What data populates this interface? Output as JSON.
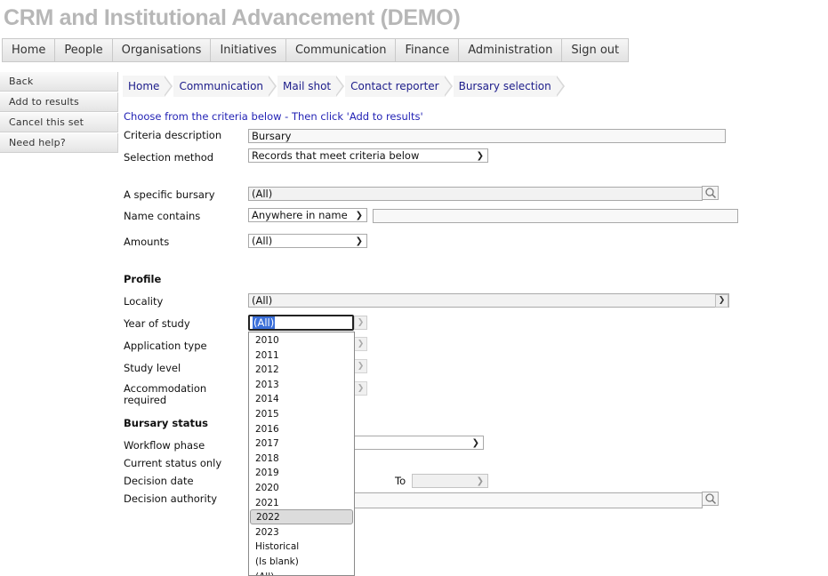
{
  "app": {
    "title": "CRM and Institutional Advancement (DEMO)"
  },
  "topnav": [
    "Home",
    "People",
    "Organisations",
    "Initiatives",
    "Communication",
    "Finance",
    "Administration",
    "Sign out"
  ],
  "sidenav": [
    "Back",
    "Add to results",
    "Cancel this set",
    "Need help?"
  ],
  "breadcrumb": [
    "Home",
    "Communication",
    "Mail shot",
    "Contact reporter",
    "Bursary selection"
  ],
  "form": {
    "instruction": "Choose from the criteria below - Then click 'Add to results'",
    "criteria_description": {
      "label": "Criteria description",
      "value": "Bursary"
    },
    "selection_method": {
      "label": "Selection method",
      "value": "Records that meet criteria below"
    },
    "specific_bursary": {
      "label": "A specific bursary",
      "value": "(All)"
    },
    "name_contains": {
      "label": "Name contains",
      "mode": "Anywhere in name",
      "value": ""
    },
    "amounts": {
      "label": "Amounts",
      "value": "(All)"
    },
    "profile_heading": "Profile",
    "locality": {
      "label": "Locality",
      "value": "(All)"
    },
    "year_of_study": {
      "label": "Year of study",
      "value": "(All)"
    },
    "application_type": {
      "label": "Application type"
    },
    "study_level": {
      "label": "Study level"
    },
    "accommodation_required": {
      "label_line1": "Accommodation",
      "label_line2": "required"
    },
    "bursary_status_heading": "Bursary status",
    "workflow_phase": {
      "label": "Workflow phase"
    },
    "current_status_only": {
      "label": "Current status only"
    },
    "decision_date": {
      "label": "Decision date",
      "to_label": "To"
    },
    "decision_authority": {
      "label": "Decision authority"
    }
  },
  "year_dropdown": {
    "options": [
      "2010",
      "2011",
      "2012",
      "2013",
      "2014",
      "2015",
      "2016",
      "2017",
      "2018",
      "2019",
      "2020",
      "2021",
      "2022",
      "2023",
      "Historical",
      "(Is blank)",
      "(All)"
    ],
    "highlighted": "2022"
  },
  "colors": {
    "title": "#b7b7b7",
    "link": "#1c1c8a",
    "instruction": "#2323b5",
    "selection": "#3b6fd9"
  },
  "icons": {
    "lookup": "search-icon",
    "dropdown": "chevron-down-icon"
  }
}
